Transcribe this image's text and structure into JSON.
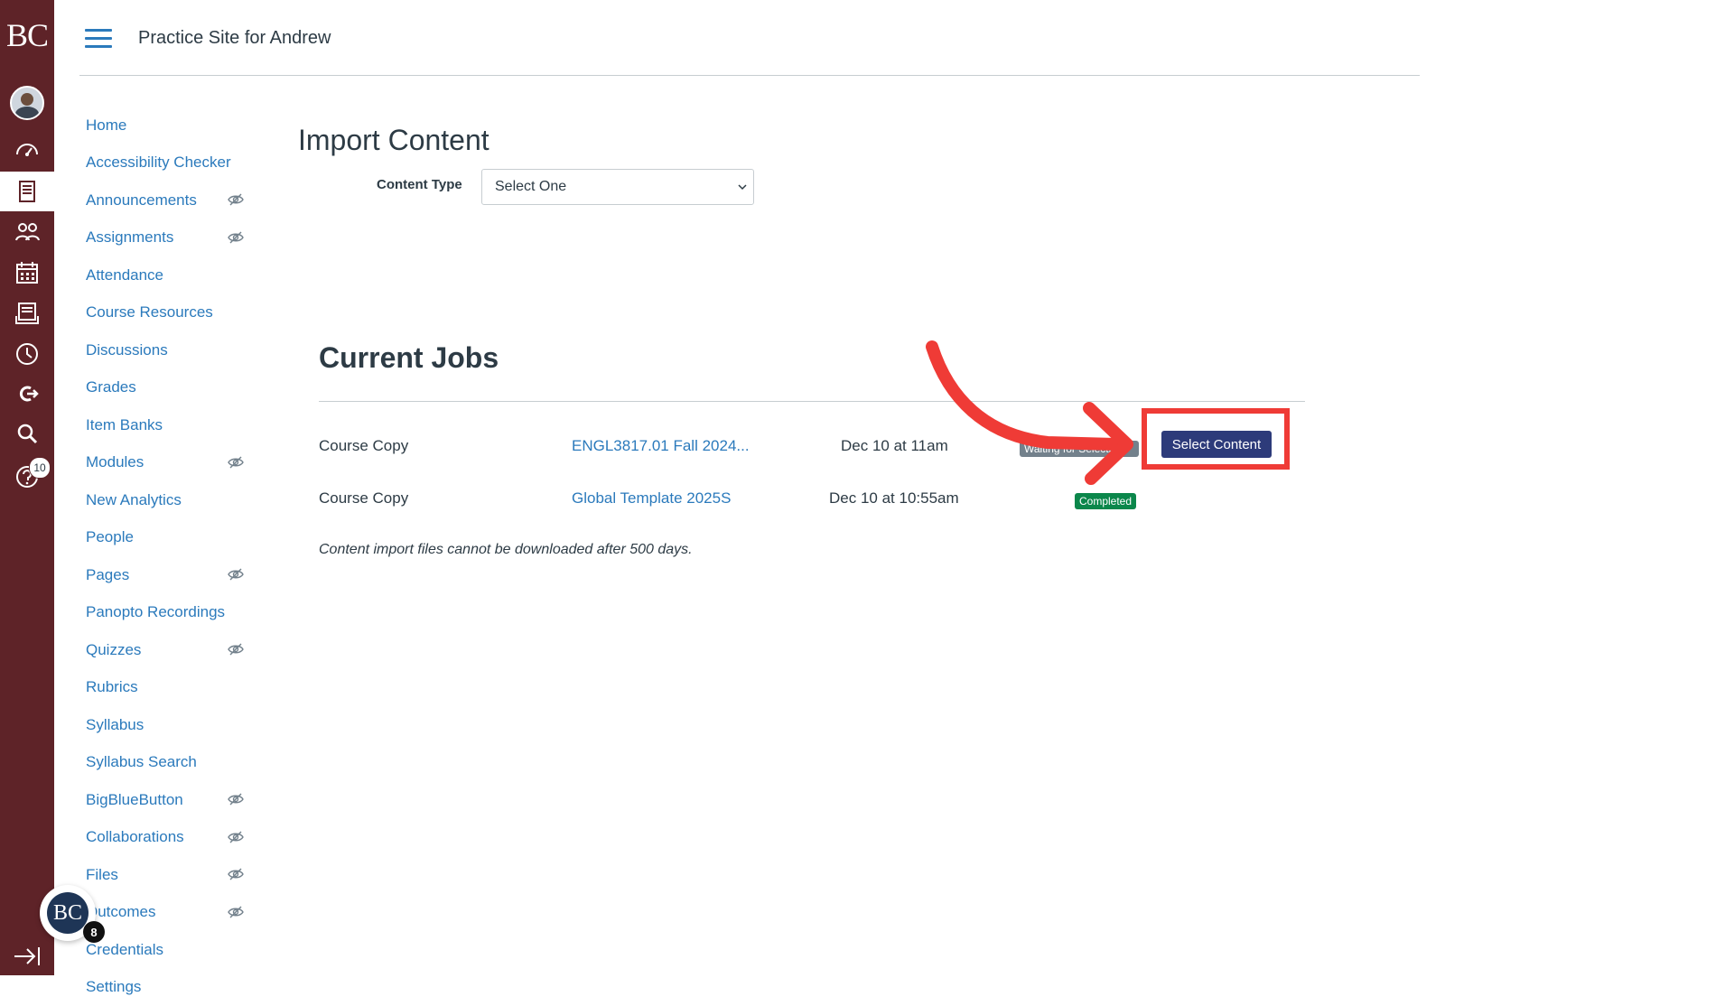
{
  "global_nav": {
    "logo": "BC",
    "items": [
      {
        "icon": "account-avatar-icon"
      },
      {
        "icon": "dashboard-icon"
      },
      {
        "icon": "courses-icon",
        "active": true
      },
      {
        "icon": "groups-icon"
      },
      {
        "icon": "calendar-icon"
      },
      {
        "icon": "inbox-icon"
      },
      {
        "icon": "history-icon"
      },
      {
        "icon": "commons-icon"
      },
      {
        "icon": "search-icon"
      },
      {
        "icon": "help-icon",
        "badge": "10"
      }
    ],
    "collapse_icon": "collapse-nav-icon"
  },
  "header": {
    "course_title": "Practice Site for Andrew"
  },
  "course_nav": {
    "items": [
      {
        "label": "Home",
        "hidden": false
      },
      {
        "label": "Accessibility Checker",
        "hidden": false
      },
      {
        "label": "Announcements",
        "hidden": true
      },
      {
        "label": "Assignments",
        "hidden": true
      },
      {
        "label": "Attendance",
        "hidden": false
      },
      {
        "label": "Course Resources",
        "hidden": false
      },
      {
        "label": "Discussions",
        "hidden": false
      },
      {
        "label": "Grades",
        "hidden": false
      },
      {
        "label": "Item Banks",
        "hidden": false
      },
      {
        "label": "Modules",
        "hidden": true
      },
      {
        "label": "New Analytics",
        "hidden": false
      },
      {
        "label": "People",
        "hidden": false
      },
      {
        "label": "Pages",
        "hidden": true
      },
      {
        "label": "Panopto Recordings",
        "hidden": false
      },
      {
        "label": "Quizzes",
        "hidden": true
      },
      {
        "label": "Rubrics",
        "hidden": false
      },
      {
        "label": "Syllabus",
        "hidden": false
      },
      {
        "label": "Syllabus Search",
        "hidden": false
      },
      {
        "label": "BigBlueButton",
        "hidden": true
      },
      {
        "label": "Collaborations",
        "hidden": true
      },
      {
        "label": "Files",
        "hidden": true
      },
      {
        "label": "Outcomes",
        "hidden": true
      },
      {
        "label": "Credentials",
        "hidden": false
      },
      {
        "label": "Settings",
        "hidden": false
      }
    ]
  },
  "import": {
    "title": "Import Content",
    "content_type_label": "Content Type",
    "content_type_value": "Select One"
  },
  "jobs": {
    "title": "Current Jobs",
    "rows": [
      {
        "type": "Course Copy",
        "name": "ENGL3817.01 Fall 2024...",
        "date": "Dec 10 at 11am",
        "status": "Waiting for Selection",
        "status_kind": "waiting",
        "action": "Select Content"
      },
      {
        "type": "Course Copy",
        "name": "Global Template 2025S",
        "date": "Dec 10 at 10:55am",
        "status": "Completed",
        "status_kind": "done"
      }
    ],
    "note": "Content import files cannot be downloaded after 500 days."
  },
  "floating_widget": {
    "label": "BC",
    "badge": "8"
  },
  "colors": {
    "rail": "#5e2328",
    "link": "#2b7abc",
    "button": "#2d3b7a",
    "highlight": "#ef3b36",
    "completed": "#0b874b",
    "waiting": "#73818c"
  }
}
